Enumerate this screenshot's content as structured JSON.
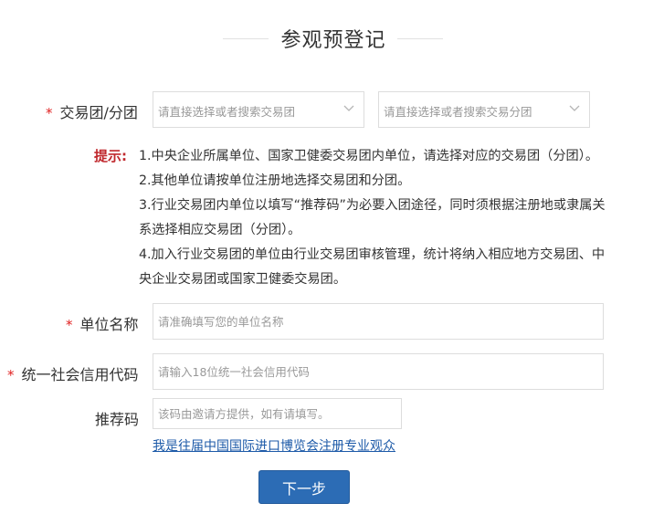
{
  "page": {
    "title": "参观预登记"
  },
  "form": {
    "trade_group": {
      "required_mark": "*",
      "label": "交易团/分团",
      "group_select_placeholder": "请直接选择或者搜索交易团",
      "subgroup_select_placeholder": "请直接选择或者搜索交易分团"
    },
    "hints": {
      "label": "提示:",
      "lines": [
        "1.中央企业所属单位、国家卫健委交易团内单位，请选择对应的交易团（分团）。",
        "2.其他单位请按单位注册地选择交易团和分团。",
        "3.行业交易团内单位以填写“推荐码”为必要入团途径，同时须根据注册地或隶属关",
        "系选择相应交易团（分团）。",
        "4.加入行业交易团的单位由行业交易团审核管理，统计将纳入相应地方交易团、中",
        "央企业交易团或国家卫健委交易团。"
      ]
    },
    "unit_name": {
      "required_mark": "*",
      "label": "单位名称",
      "placeholder": "请准确填写您的单位名称",
      "value": ""
    },
    "credit_code": {
      "required_mark": "*",
      "label": "统一社会信用代码",
      "placeholder": "请输入18位统一社会信用代码",
      "value": ""
    },
    "referral_code": {
      "label": "推荐码",
      "placeholder": "该码由邀请方提供，如有请填写。",
      "value": ""
    },
    "past_visitor_link": "我是往届中国国际进口博览会注册专业观众",
    "next_button": "下一步"
  },
  "icons": {
    "select_arrow": "chevron-down-icon"
  },
  "colors": {
    "required": "#e02020",
    "hint_label": "#c0282d",
    "primary_button": "#2c6cb5",
    "link": "#1d5aa8"
  }
}
